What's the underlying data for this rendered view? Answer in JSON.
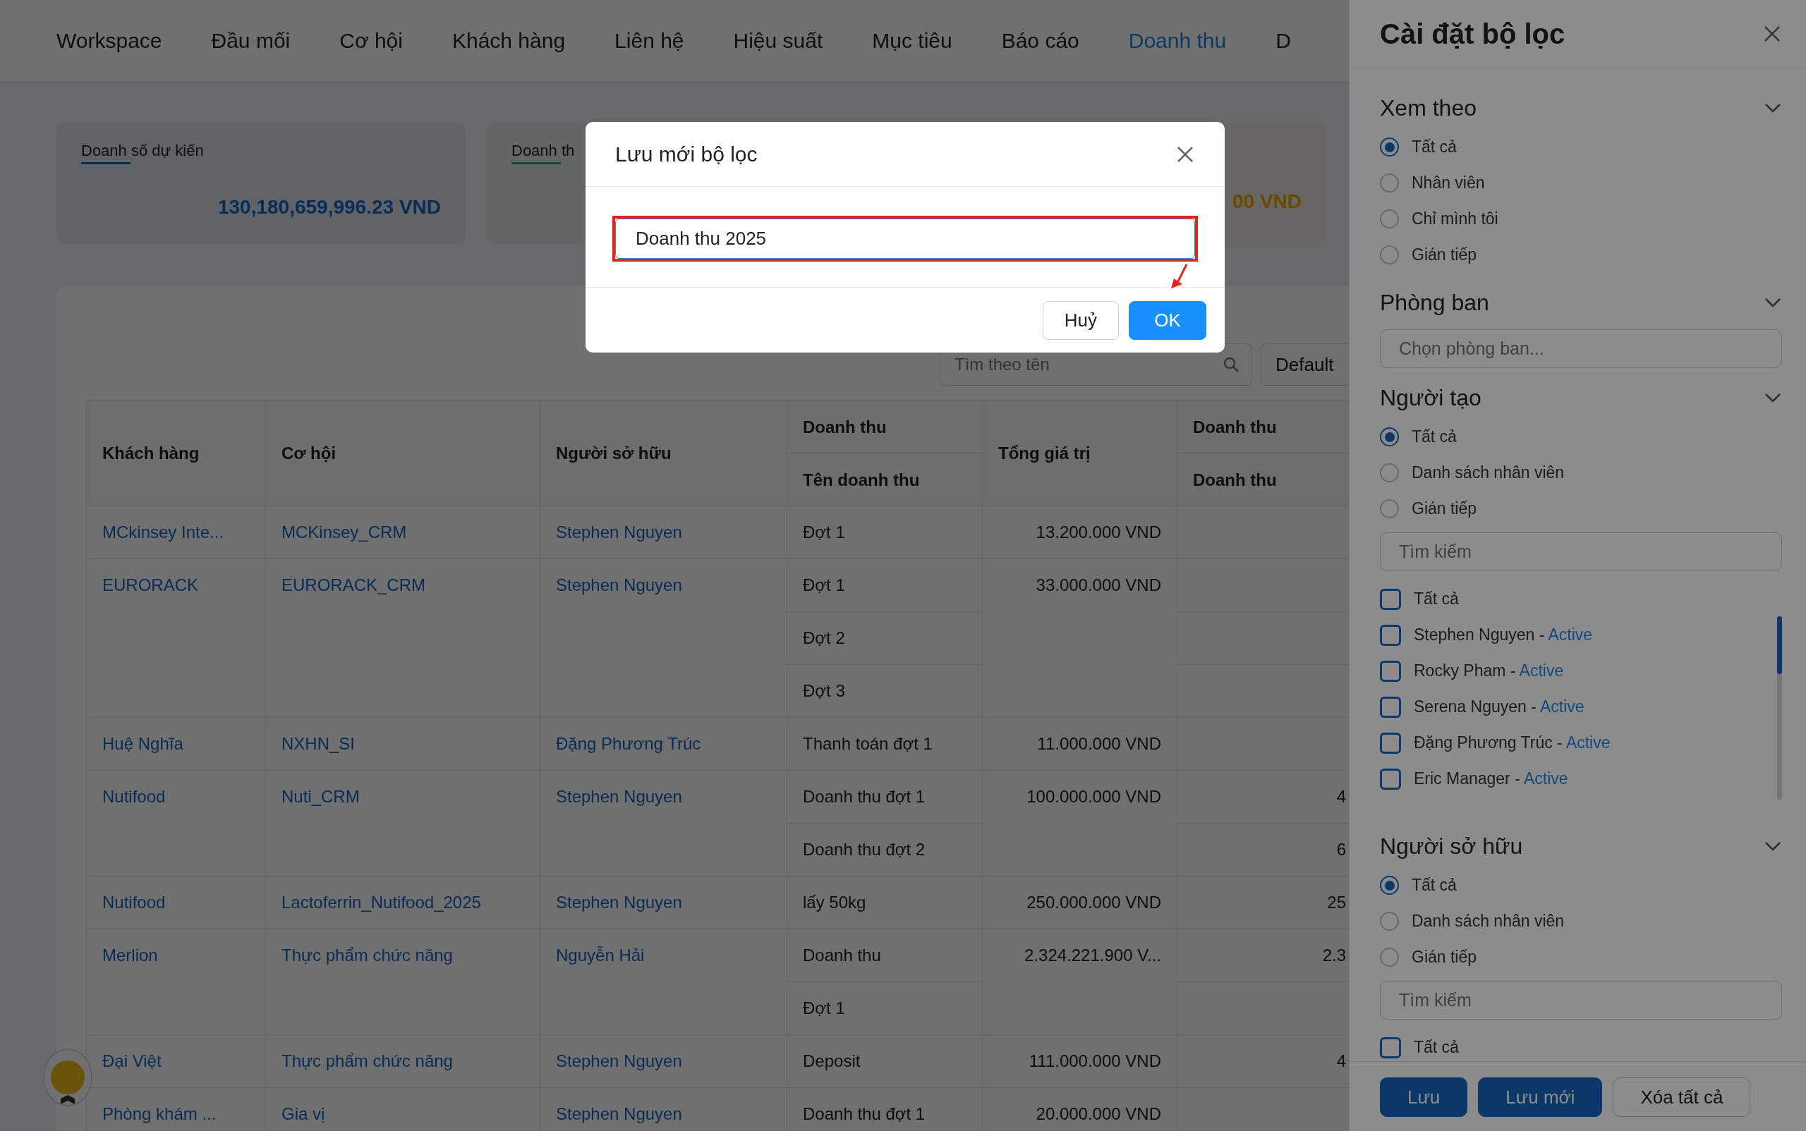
{
  "nav": {
    "items": [
      {
        "label": "Workspace",
        "selected": false
      },
      {
        "label": "Đầu mối",
        "selected": false
      },
      {
        "label": "Cơ hội",
        "selected": false
      },
      {
        "label": "Khách hàng",
        "selected": false
      },
      {
        "label": "Liên hệ",
        "selected": false
      },
      {
        "label": "Hiệu suất",
        "selected": false
      },
      {
        "label": "Mục tiêu",
        "selected": false
      },
      {
        "label": "Báo cáo",
        "selected": false
      },
      {
        "label": "Doanh thu",
        "selected": true
      },
      {
        "label": "D",
        "selected": false
      }
    ]
  },
  "summary_cards": [
    {
      "label": "Doanh số dự kiến",
      "value": "130,180,659,996.23 VND",
      "kind": "primary"
    },
    {
      "label": "Doanh th",
      "kind": "success"
    },
    {
      "value": "00 VND",
      "kind": "warning"
    }
  ],
  "toolbar": {
    "search": {
      "placeholder": "Tìm theo tên"
    },
    "view_select": {
      "value": "Default"
    }
  },
  "table": {
    "columns": [
      {
        "label": "Khách hàng"
      },
      {
        "label": "Cơ hội"
      },
      {
        "label": "Người sở hữu"
      },
      {
        "group": "Doanh thu",
        "label": "Tên doanh thu"
      },
      {
        "label": "Tổng giá trị"
      },
      {
        "group": "Doanh thu",
        "label": "Doanh thu"
      }
    ],
    "rows": [
      {
        "customer": "MCkinsey Inte...",
        "opportunity": "MCKinsey_CRM",
        "owner": "Stephen Nguyen",
        "sub_rows": [
          {
            "revenue_name": "Đợt 1"
          }
        ],
        "total": "13.200.000 VND"
      },
      {
        "customer": "EURORACK",
        "opportunity": "EURORACK_CRM",
        "owner": "Stephen Nguyen",
        "sub_rows": [
          {
            "revenue_name": "Đợt 1"
          },
          {
            "revenue_name": "Đợt 2"
          },
          {
            "revenue_name": "Đợt 3"
          }
        ],
        "total": "33.000.000 VND"
      },
      {
        "customer": "Huệ Nghĩa",
        "opportunity": "NXHN_SI",
        "owner": "Đặng Phương Trúc",
        "sub_rows": [
          {
            "revenue_name": "Thanh toán đợt 1"
          }
        ],
        "total": "11.000.000 VND"
      },
      {
        "customer": "Nutifood",
        "opportunity": "Nuti_CRM",
        "owner": "Stephen Nguyen",
        "sub_rows": [
          {
            "revenue_name": "Doanh thu đợt 1",
            "column_6": "4"
          },
          {
            "revenue_name": "Doanh thu đợt 2",
            "column_6": "6"
          }
        ],
        "total": "100.000.000 VND"
      },
      {
        "customer": "Nutifood",
        "opportunity": "Lactoferrin_Nutifood_2025",
        "owner": "Stephen Nguyen",
        "sub_rows": [
          {
            "revenue_name": "lấy 50kg",
            "column_6": "25"
          }
        ],
        "total": "250.000.000 VND"
      },
      {
        "customer": "Merlion",
        "opportunity": "Thực phẩm chức năng",
        "owner": "Nguyễn Hải",
        "sub_rows": [
          {
            "revenue_name": "Doanh thu",
            "column_6": "2.3"
          },
          {
            "revenue_name": "Đợt 1"
          }
        ],
        "total": "2.324.221.900 V..."
      },
      {
        "customer": "Đại Việt",
        "opportunity": "Thực phẩm chức năng",
        "owner": "Stephen Nguyen",
        "sub_rows": [
          {
            "revenue_name": "Deposit",
            "column_6": "4"
          }
        ],
        "total": "111.000.000 VND"
      },
      {
        "customer": "Phòng khám ...",
        "opportunity": "Gia vị",
        "owner": "Stephen Nguyen",
        "sub_rows": [
          {
            "revenue_name": "Doanh thu đợt 1"
          }
        ],
        "total": "20.000.000 VND"
      }
    ]
  },
  "modal": {
    "title": "Lưu mới bộ lọc",
    "input": {
      "value": "Doanh thu 2025",
      "highlighted": true
    },
    "buttons": [
      {
        "label": "Huỷ",
        "kind": "secondary"
      },
      {
        "label": "OK",
        "kind": "primary",
        "pointed": true
      }
    ]
  },
  "filter_panel": {
    "title": "Cài đặt bộ lọc",
    "sections": [
      {
        "title": "Xem theo",
        "options": [
          {
            "label": "Tất cả",
            "selected": true
          },
          {
            "label": "Nhân viên",
            "selected": false
          },
          {
            "label": "Chỉ mình tôi",
            "selected": false
          },
          {
            "label": "Gián tiếp",
            "selected": false
          }
        ]
      },
      {
        "title": "Phòng ban",
        "select": {
          "placeholder": "Chọn phòng ban..."
        }
      },
      {
        "title": "Người tạo",
        "options": [
          {
            "label": "Tất cả",
            "selected": true
          },
          {
            "label": "Danh sách nhân viên",
            "selected": false
          },
          {
            "label": "Gián tiếp",
            "selected": false
          }
        ],
        "search": {
          "placeholder": "Tìm kiếm"
        },
        "checkboxes": [
          {
            "label": "Tất cả",
            "checked": false
          },
          {
            "label": "Stephen Nguyen -",
            "status": "Active",
            "checked": false
          },
          {
            "label": "Rocky Pham -",
            "status": "Active",
            "checked": false
          },
          {
            "label": "Serena Nguyen -",
            "status": "Active",
            "checked": false
          },
          {
            "label": "Đặng Phương Trúc -",
            "status": "Active",
            "checked": false
          },
          {
            "label": "Eric Manager -",
            "status": "Active",
            "checked": false
          }
        ]
      },
      {
        "title": "Người sở hữu",
        "options": [
          {
            "label": "Tất cả",
            "selected": true
          },
          {
            "label": "Danh sách nhân viên",
            "selected": false
          },
          {
            "label": "Gián tiếp",
            "selected": false
          }
        ],
        "search": {
          "placeholder": "Tìm kiếm"
        },
        "checkboxes": [
          {
            "label": "Tất cả",
            "checked": false
          }
        ]
      }
    ],
    "buttons": [
      {
        "label": "Lưu",
        "kind": "primary"
      },
      {
        "label": "Lưu mới",
        "kind": "primary"
      },
      {
        "label": "Xóa tất cả",
        "kind": "secondary"
      }
    ]
  }
}
